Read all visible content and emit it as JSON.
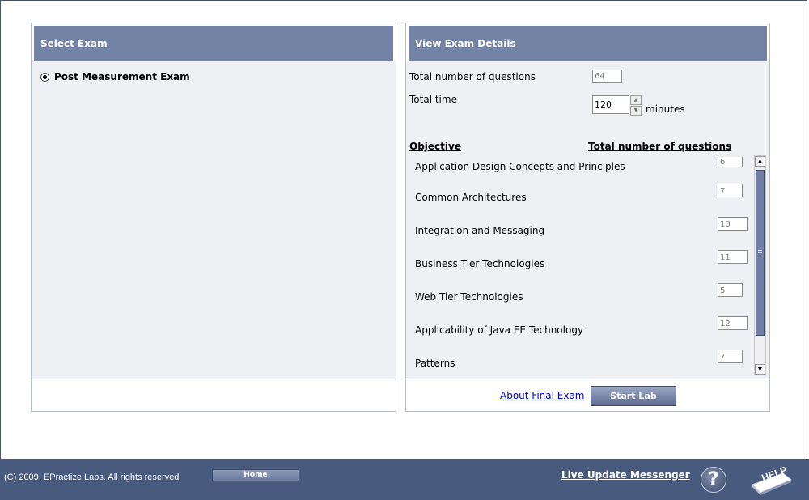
{
  "left_panel": {
    "title": "Select Exam",
    "exam_option": "Post Measurement Exam"
  },
  "right_panel": {
    "title": "View Exam Details",
    "total_questions_label": "Total number of questions",
    "total_questions_value": "64",
    "total_time_label": "Total time",
    "total_time_value": "120",
    "minutes_label": "minutes",
    "objective_header": "Objective",
    "count_header": "Total number of questions",
    "objectives": [
      {
        "name": "Application Design Concepts and Principles",
        "count": "6"
      },
      {
        "name": "Common Architectures",
        "count": "7"
      },
      {
        "name": "Integration and Messaging",
        "count": "10"
      },
      {
        "name": "Business Tier Technologies",
        "count": "11"
      },
      {
        "name": "Web Tier Technologies",
        "count": "5"
      },
      {
        "name": "Applicability of Java EE Technology",
        "count": "12"
      },
      {
        "name": "Patterns",
        "count": "7"
      }
    ],
    "about_link": "About Final Exam",
    "start_button": "Start Lab"
  },
  "footer": {
    "copyright": "(C) 2009. EPractize Labs. All rights reserved",
    "home_button": "Home",
    "live_update": "Live Update Messenger",
    "question_icon_glyph": "?",
    "help_label": "HELP"
  },
  "colors": {
    "header_bg": "#7383a5",
    "footer_bg": "#495a7f",
    "panel_body_bg": "#eef0f4"
  }
}
